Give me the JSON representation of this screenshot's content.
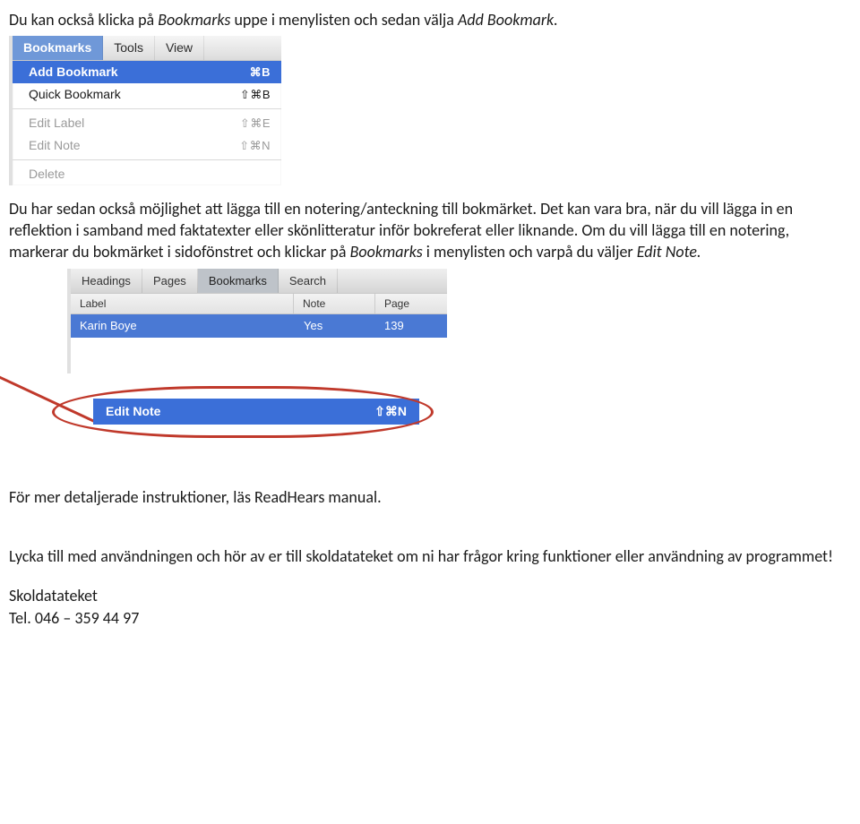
{
  "intro": {
    "t1": "Du kan också klicka på ",
    "t2": "Bookmarks",
    "t3": " uppe i menylisten och sedan välja ",
    "t4": "Add Bookmark.",
    "t5": ""
  },
  "menu1": {
    "menubar": [
      "Bookmarks",
      "Tools",
      "View"
    ],
    "items": [
      {
        "label": "Add Bookmark",
        "sc": "⌘B",
        "sel": true,
        "disabled": false
      },
      {
        "label": "Quick Bookmark",
        "sc": "⇧⌘B",
        "sel": false,
        "disabled": false
      }
    ],
    "items2": [
      {
        "label": "Edit Label",
        "sc": "⇧⌘E",
        "disabled": true
      },
      {
        "label": "Edit Note",
        "sc": "⇧⌘N",
        "disabled": true
      }
    ],
    "items3": [
      {
        "label": "Delete",
        "sc": "",
        "disabled": true
      }
    ]
  },
  "mid": {
    "p1": "Du har sedan också möjlighet att lägga till en notering/anteckning till bokmärket. Det kan vara bra, när du vill lägga in en reflektion i samband med faktatexter eller skönlitteratur inför bokreferat eller liknande. Om du vill lägga till en notering, markerar du bokmärket i sidofönstret och klickar på ",
    "p1b": "Bookmarks",
    "p1c": " i menylisten och varpå du väljer ",
    "p1d": "Edit Note.",
    "p1e": ""
  },
  "bmpanel": {
    "tabs": [
      "Headings",
      "Pages",
      "Bookmarks",
      "Search"
    ],
    "active_tab_index": 2,
    "headers": {
      "label": "Label",
      "note": "Note",
      "page": "Page"
    },
    "row": {
      "label": "Karin Boye",
      "note": "Yes",
      "page": "139"
    }
  },
  "editnote": {
    "label": "Edit Note",
    "sc": "⇧⌘N"
  },
  "foot": {
    "manual": "För mer detaljerade instruktioner, läs ReadHears manual.",
    "bye": "Lycka till med användningen och hör av er till skoldatateket om ni har frågor kring funktioner eller användning av programmet!",
    "org": "Skoldatateket",
    "tel_label": "Tel. ",
    "tel_num": "046 – 359 44 97"
  }
}
